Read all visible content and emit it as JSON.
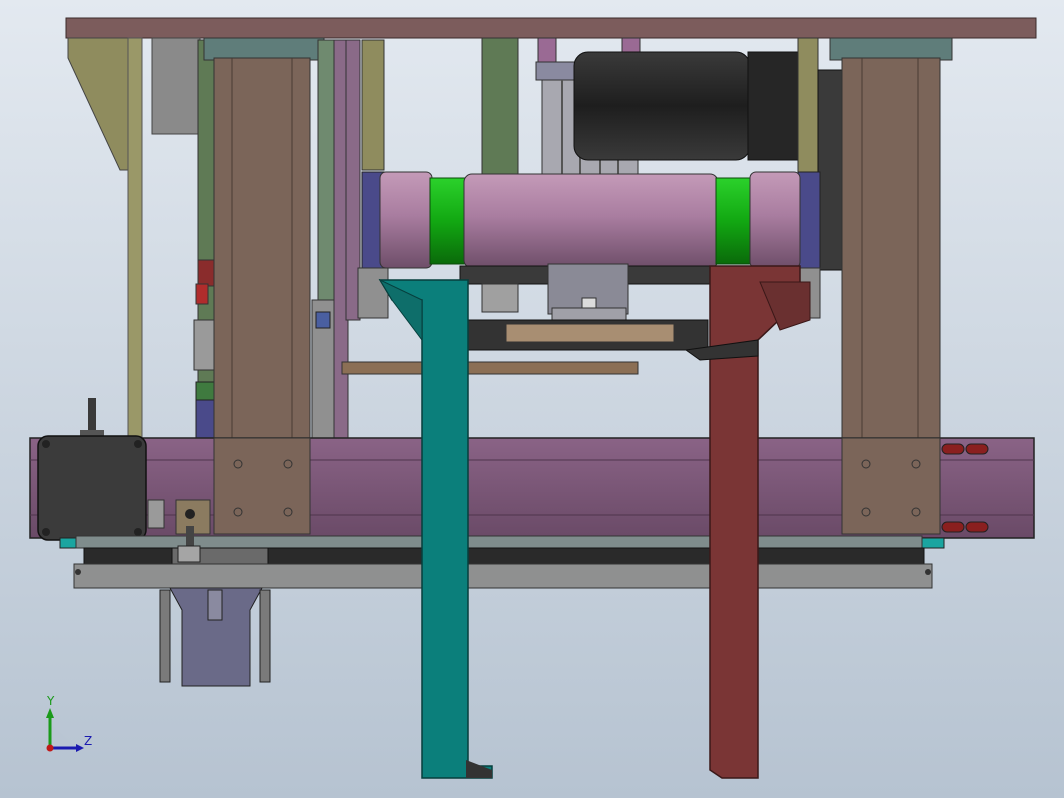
{
  "scene": {
    "background_top": "#dfe6ee",
    "background_bottom": "#b9c5d2",
    "colors": {
      "frame_purple": "#7a5577",
      "column_brown": "#7b6559",
      "teal_bracket": "#0b7f7b",
      "red_bracket": "#7a3535",
      "roller_pink": "#a97da0",
      "ring_green": "#14a514",
      "motor_black": "#2b2b2b",
      "base_grey": "#8f9090",
      "olive": "#8f8c5e",
      "green_strut": "#5a7a5a",
      "top_plate": "#7c5c5c"
    }
  },
  "triad": {
    "y_label": "Y",
    "z_label": "Z",
    "y_color": "#1a9a1a",
    "z_color": "#1a1ab0",
    "origin_color": "#c01818"
  }
}
